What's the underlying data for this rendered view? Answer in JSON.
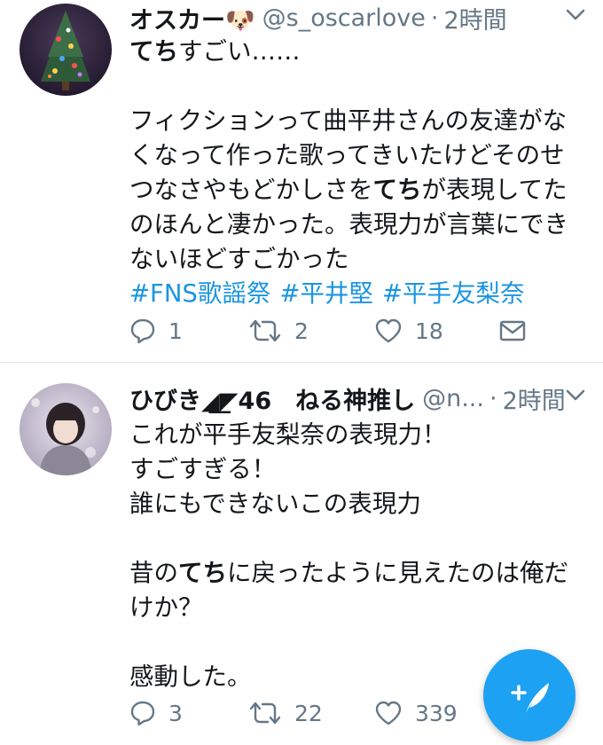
{
  "tweets": [
    {
      "name": "オスカー🐶",
      "handle": "@s_oscarlove",
      "dot": "·",
      "time": "2時間",
      "body": {
        "l1_bold": "てち",
        "l1_rest": "すごい……",
        "l2": "フィクションって曲平井さんの友達がな",
        "l3": "くなって作った歌ってきいたけどそのせ",
        "l4_pre": "つなさやもどかしさを",
        "l4_bold": "てち",
        "l4_post": "が表現してた",
        "l5": "のほんと凄かった。表現力が言葉にでき",
        "l6": "ないほどすごかった"
      },
      "hashtags": [
        "#FNS歌謡祭",
        "#平井堅",
        "#平手友梨奈"
      ],
      "replies": "1",
      "retweets": "2",
      "likes": "18"
    },
    {
      "name": "ひびき◢͟͟͟͟◤46　ねる神推し",
      "handle": "@n...",
      "dot": "·",
      "time": "2時間",
      "body": {
        "l1": "これが平手友梨奈の表現力！",
        "l2": "すごすぎる！",
        "l3": "誰にもできないこの表現力",
        "l5_pre": "昔の",
        "l5_bold": "てち",
        "l5_post": "に戻ったように見えたのは俺だ",
        "l6": "けか？",
        "l8": "感動した。"
      },
      "replies": "3",
      "retweets": "22",
      "likes": "339"
    }
  ],
  "colors": {
    "text": "#14171a",
    "secondary": "#657786",
    "hashtag": "#1b95e0",
    "accent": "#1da1f2",
    "divider": "#e1e8ed"
  },
  "icons": {
    "reply": "reply-icon",
    "retweet": "retweet-icon",
    "like": "heart-icon",
    "dm": "envelope-icon",
    "caret": "chevron-down-icon",
    "compose": "compose-tweet-icon"
  }
}
